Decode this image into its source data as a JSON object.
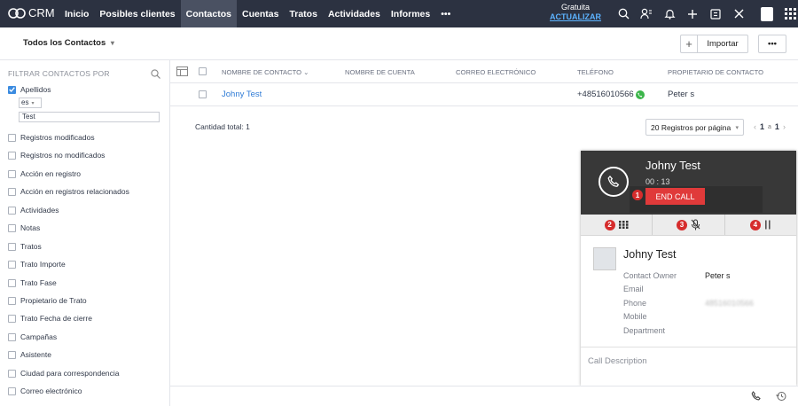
{
  "app": {
    "logo_text": "CRM"
  },
  "nav": {
    "tabs": [
      {
        "label": "Inicio"
      },
      {
        "label": "Posibles clientes"
      },
      {
        "label": "Contactos"
      },
      {
        "label": "Cuentas"
      },
      {
        "label": "Tratos"
      },
      {
        "label": "Actividades"
      },
      {
        "label": "Informes"
      },
      {
        "label": "•••"
      }
    ],
    "active_tab": "Contactos",
    "plan_label": "Gratuita",
    "upgrade_label": "ACTUALIZAR",
    "icons": [
      "search-icon",
      "contacts-icon",
      "bell-icon",
      "plus-icon",
      "calendar-icon",
      "tools-icon",
      "profile-icon",
      "apps-grid-icon"
    ]
  },
  "view": {
    "selector_label": "Todos los Contactos",
    "import_label": "Importar",
    "more_label": "•••"
  },
  "filters": {
    "title": "FILTRAR CONTACTOS POR",
    "active_filter": {
      "label": "Apellidos",
      "operator": "es",
      "value": "Test"
    },
    "items": [
      "Registros modificados",
      "Registros no modificados",
      "Acción en registro",
      "Acción en registros relacionados",
      "Actividades",
      "Notas",
      "Tratos",
      "Trato Importe",
      "Trato Fase",
      "Propietario de Trato",
      "Trato Fecha de cierre",
      "Campañas",
      "Asistente",
      "Ciudad para correspondencia",
      "Correo electrónico"
    ]
  },
  "table": {
    "headers": {
      "contact_name": "NOMBRE DE CONTACTO",
      "account_name": "NOMBRE DE CUENTA",
      "email": "CORREO ELECTRÓNICO",
      "phone": "TELÉFONO",
      "owner": "PROPIETARIO DE CONTACTO"
    },
    "rows": [
      {
        "name": "Johny Test",
        "account": "",
        "email": "",
        "phone": "+48516010566",
        "owner": "Peter s"
      }
    ],
    "total_label": "Cantidad total: 1",
    "per_page_label": "20 Registros por página",
    "page_current": "1",
    "page_of": "a",
    "page_total": "1"
  },
  "call_panel": {
    "contact_name": "Johny Test",
    "timer": "00 : 13",
    "end_call_label": "END CALL",
    "badges": [
      "1",
      "2",
      "3",
      "4"
    ],
    "card": {
      "name": "Johny Test",
      "fields": [
        {
          "label": "Contact Owner",
          "value": "Peter s"
        },
        {
          "label": "Email",
          "value": ""
        },
        {
          "label": "Phone",
          "value": "48516010566"
        },
        {
          "label": "Mobile",
          "value": ""
        },
        {
          "label": "Department",
          "value": ""
        }
      ]
    },
    "description_placeholder": "Call Description"
  },
  "colors": {
    "topbar": "#2c3241",
    "link": "#2f7bd6",
    "end_call": "#e03a3a",
    "call_header": "#383838",
    "badge": "#d62c2c"
  }
}
